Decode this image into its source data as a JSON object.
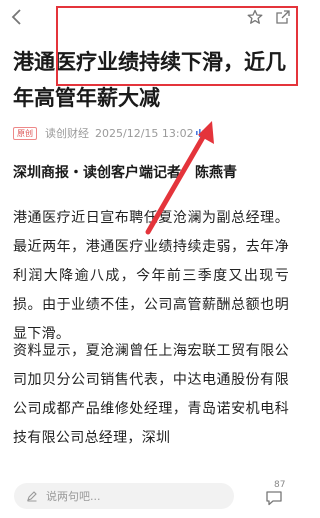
{
  "article": {
    "headline": "港通医疗业绩持续下滑，近几年高管年薪大减",
    "tag": "原创",
    "source": "读创财经",
    "datetime": "2025/12/15 13:02",
    "byline": "深圳商报・读创客户端记者　陈燕青",
    "paragraphs": [
      "港通医疗近日宣布聘任夏沧澜为副总经理。最近两年，港通医疗业绩持续走弱，去年净利润大降逾八成，今年前三季度又出现亏损。由于业绩不佳，公司高管薪酬总额也明显下滑。",
      "资料显示，夏沧澜曾任上海宏联工贸有限公司加贝分公司销售代表，中达电通股份有限公司成都产品维修处经理，青岛诺安机电科技有限公司总经理，深圳"
    ]
  },
  "bottom_bar": {
    "comment_placeholder": "说两句吧...",
    "comment_count": "87"
  },
  "icons": {
    "back": "back-arrow-icon",
    "favorite": "star-icon",
    "share": "share-icon",
    "audio": "audio-wave-icon",
    "edit": "pencil-icon",
    "comment": "comment-bubble-icon"
  },
  "colors": {
    "annotation": "#e4343b",
    "tag": "#d55555",
    "muted": "#9a9a9a"
  }
}
